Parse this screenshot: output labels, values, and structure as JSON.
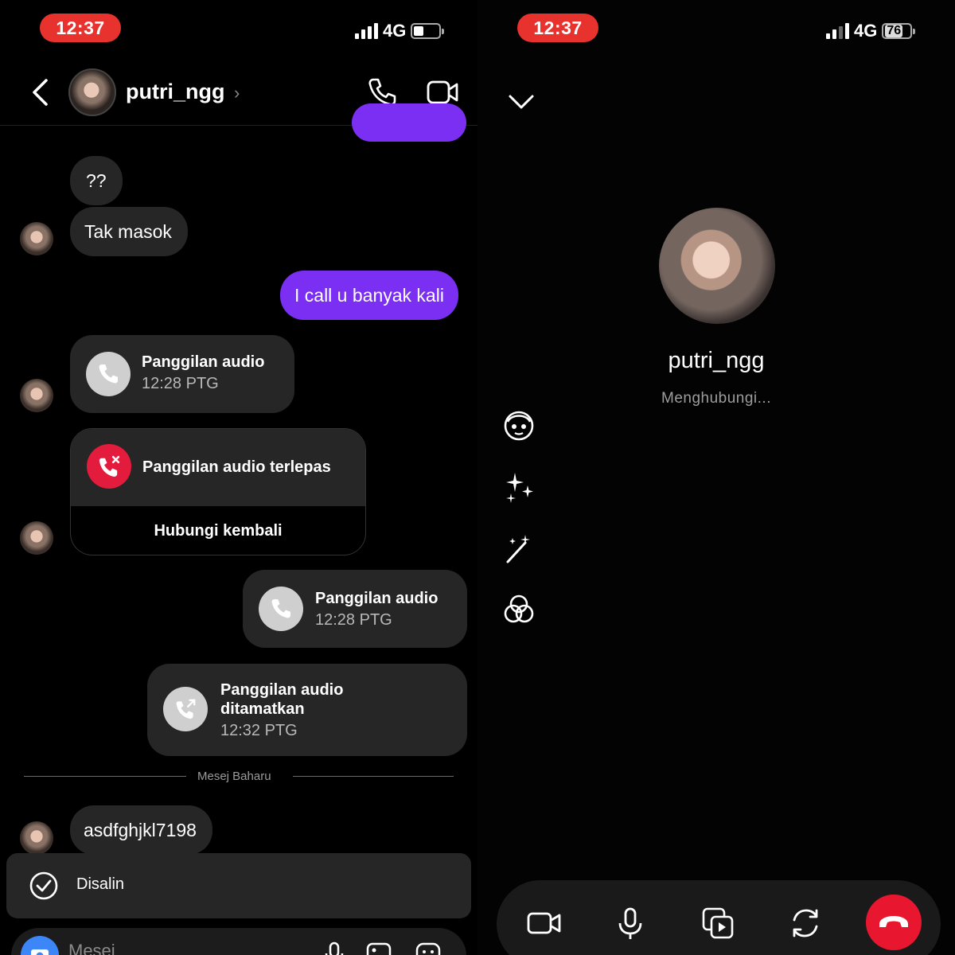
{
  "left": {
    "status": {
      "time": "12:37",
      "network": "4G"
    },
    "header": {
      "username": "putri_ngg",
      "chevron": "›"
    },
    "messages": {
      "m1": "??",
      "m2": "Tak masok",
      "m3": "I call u banyak kali",
      "m7": "asdfghjkl7198"
    },
    "calls": {
      "c1": {
        "title": "Panggilan audio",
        "time": "12:28 PTG"
      },
      "c2": {
        "title": "Panggilan audio terlepas",
        "action": "Hubungi kembali"
      },
      "c3": {
        "title": "Panggilan audio",
        "time": "12:28 PTG"
      },
      "c4": {
        "title": "Panggilan audio ditamatkan",
        "time": "12:32 PTG"
      }
    },
    "divider": "Mesej Baharu",
    "toast": "Disalin",
    "composer": {
      "placeholder": "Mesej"
    }
  },
  "right": {
    "status": {
      "time": "12:37",
      "network": "4G",
      "battery": "76"
    },
    "call": {
      "name": "putri_ngg",
      "status": "Menghubungi..."
    }
  },
  "colors": {
    "accent": "#7b2ff2",
    "bubble_in": "#262626",
    "missed": "#e31b3c",
    "time_pill": "#e8322e",
    "end_call": "#e8172f"
  },
  "icons": [
    "back-icon",
    "phone-icon",
    "video-icon",
    "missed-call-icon",
    "outgoing-call-icon",
    "check-icon",
    "camera-icon",
    "microphone-icon",
    "gallery-icon",
    "sticker-icon",
    "chevron-down-icon",
    "avatar-effect-icon",
    "sparkles-icon",
    "magic-wand-icon",
    "filters-icon",
    "flip-camera-icon",
    "end-call-icon"
  ]
}
